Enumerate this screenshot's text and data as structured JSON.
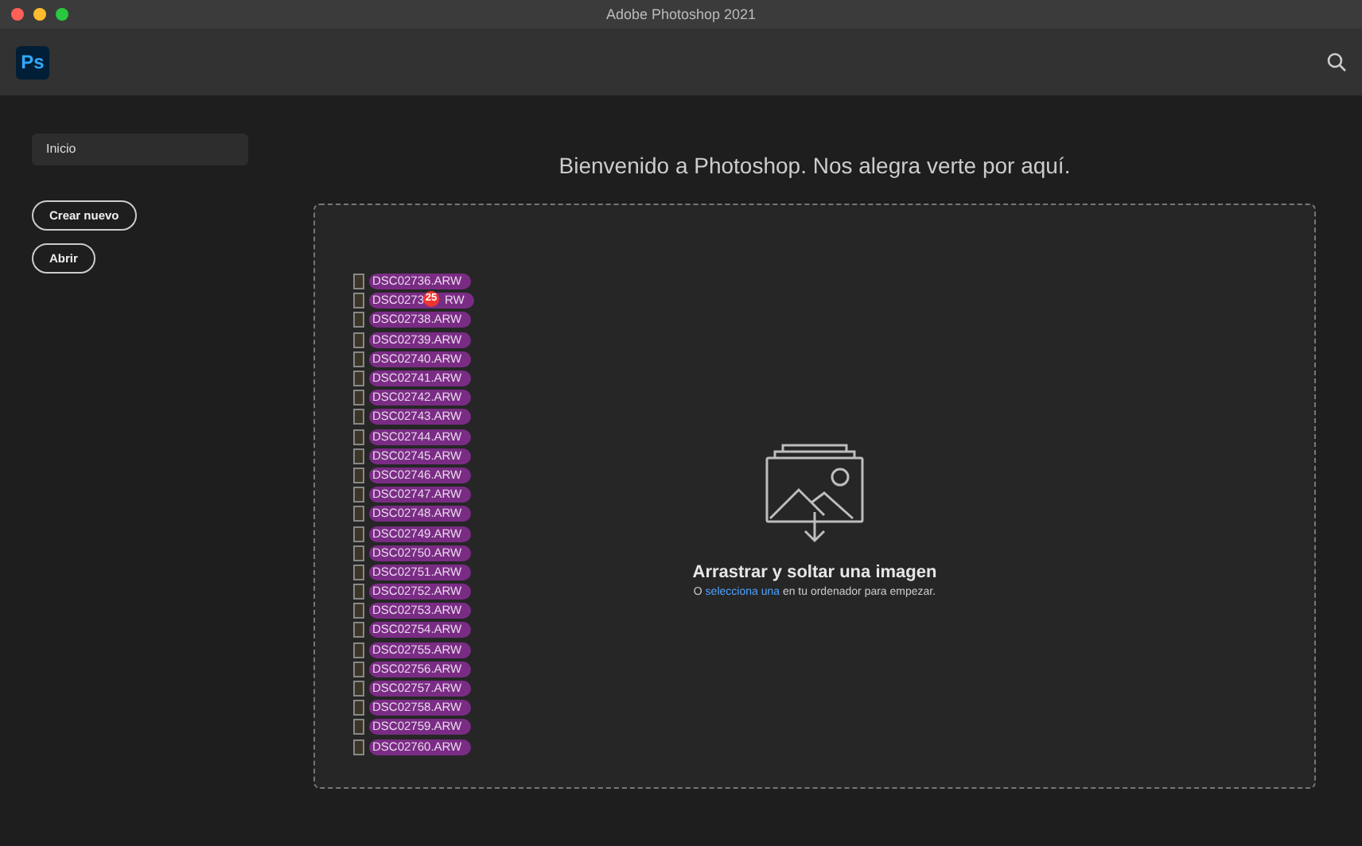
{
  "window": {
    "title": "Adobe Photoshop 2021"
  },
  "app_logo": "Ps",
  "sidebar": {
    "items": [
      {
        "label": "Inicio",
        "selected": true
      }
    ],
    "buttons": [
      "Crear nuevo",
      "Abrir"
    ]
  },
  "welcome": "Bienvenido a Photoshop. Nos alegra verte por aquí.",
  "drop_zone": {
    "heading": "Arrastrar y soltar una imagen",
    "prefix": "O ",
    "link": "selecciona una",
    "suffix": " en tu ordenador para empezar."
  },
  "dragged_files": {
    "count_badge": "25",
    "files": [
      {
        "name": "DSC02736.ARW"
      },
      {
        "name": "DSC0273",
        "name_after_badge": "RW",
        "badge": true
      },
      {
        "name": "DSC02738.ARW"
      },
      {
        "name": "DSC02739.ARW"
      },
      {
        "name": "DSC02740.ARW"
      },
      {
        "name": "DSC02741.ARW"
      },
      {
        "name": "DSC02742.ARW"
      },
      {
        "name": "DSC02743.ARW"
      },
      {
        "name": "DSC02744.ARW"
      },
      {
        "name": "DSC02745.ARW"
      },
      {
        "name": "DSC02746.ARW"
      },
      {
        "name": "DSC02747.ARW"
      },
      {
        "name": "DSC02748.ARW"
      },
      {
        "name": "DSC02749.ARW"
      },
      {
        "name": "DSC02750.ARW"
      },
      {
        "name": "DSC02751.ARW"
      },
      {
        "name": "DSC02752.ARW"
      },
      {
        "name": "DSC02753.ARW"
      },
      {
        "name": "DSC02754.ARW"
      },
      {
        "name": "DSC02755.ARW"
      },
      {
        "name": "DSC02756.ARW"
      },
      {
        "name": "DSC02757.ARW"
      },
      {
        "name": "DSC02758.ARW"
      },
      {
        "name": "DSC02759.ARW"
      },
      {
        "name": "DSC02760.ARW"
      }
    ]
  }
}
